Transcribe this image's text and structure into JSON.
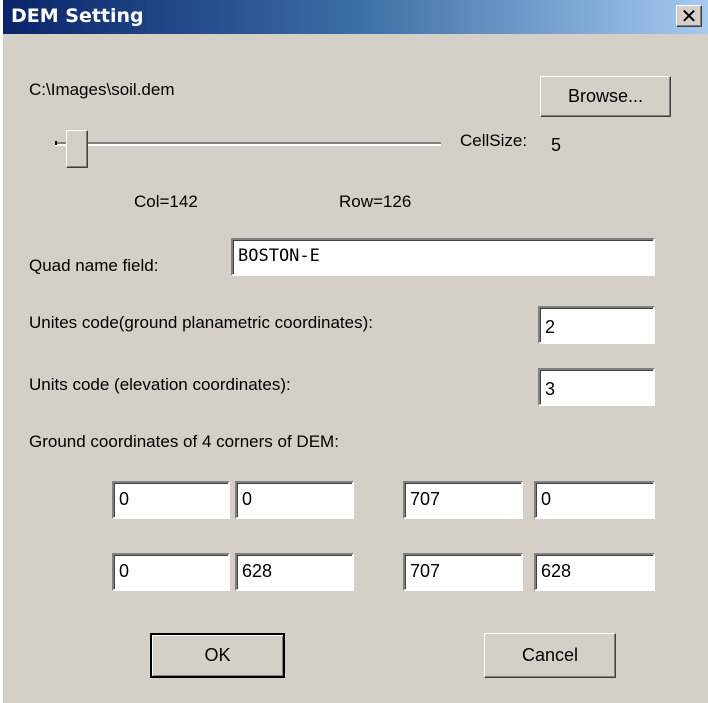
{
  "window": {
    "title": "DEM Setting",
    "close_glyph": "✕"
  },
  "file": {
    "path": "C:\\Images\\soil.dem",
    "browse_label": "Browse..."
  },
  "cellsize": {
    "label": "CellSize:",
    "value": "5",
    "slider_fraction": 0.03
  },
  "grid": {
    "col": "Col=142",
    "row": "Row=126"
  },
  "quad": {
    "label": "Quad name field:",
    "value": "BOSTON-E"
  },
  "units_ground": {
    "label": "Unites code(ground planametric coordinates):",
    "value": "2"
  },
  "units_elev": {
    "label": "Units code (elevation coordinates):",
    "value": "3"
  },
  "corners": {
    "label": "Ground coordinates of 4 corners of DEM:",
    "row1": [
      "0",
      "0",
      "707",
      "0"
    ],
    "row2": [
      "0",
      "628",
      "707",
      "628"
    ]
  },
  "buttons": {
    "ok": "OK",
    "cancel": "Cancel"
  }
}
